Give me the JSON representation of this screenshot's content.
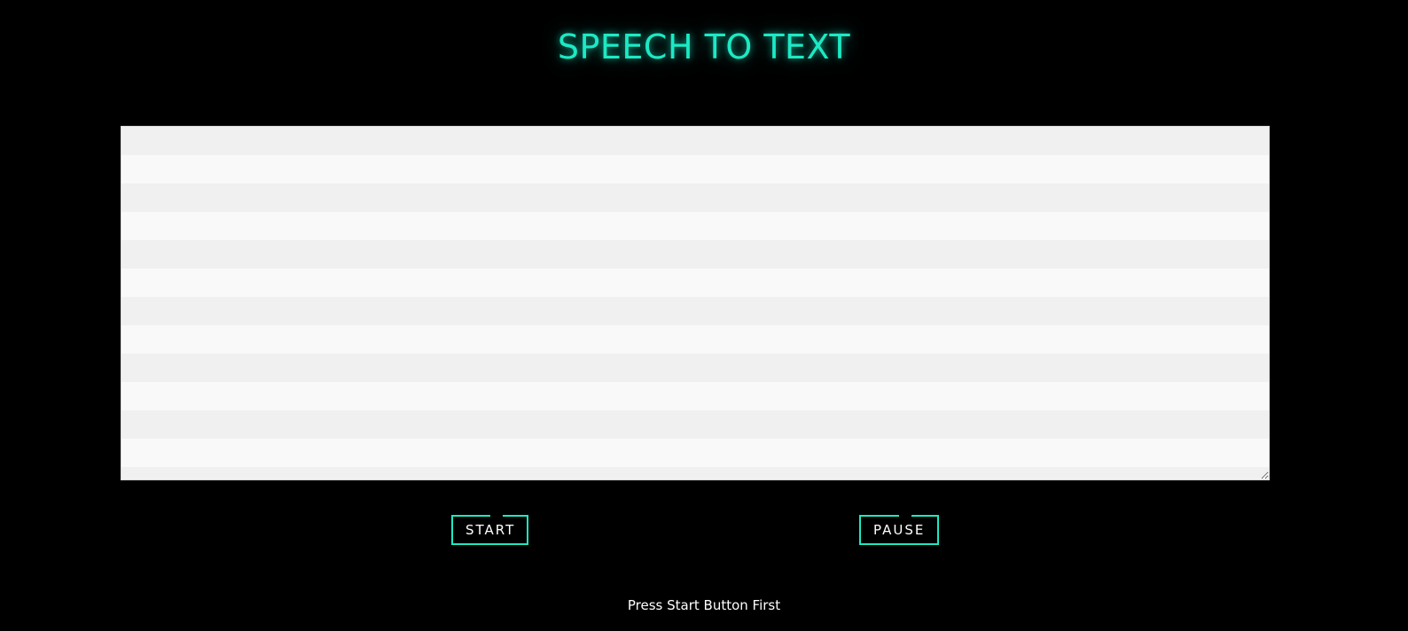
{
  "header": {
    "title": "SPEECH TO TEXT"
  },
  "transcript": {
    "value": "",
    "placeholder": ""
  },
  "controls": {
    "start_label": "START",
    "pause_label": "PAUSE"
  },
  "status": {
    "message": "Press Start Button First"
  },
  "colors": {
    "background": "#000000",
    "accent": "#1de9c4",
    "text": "#ffffff",
    "stripe_light": "#f9f9f9",
    "stripe_dark": "#f0f0f0"
  }
}
